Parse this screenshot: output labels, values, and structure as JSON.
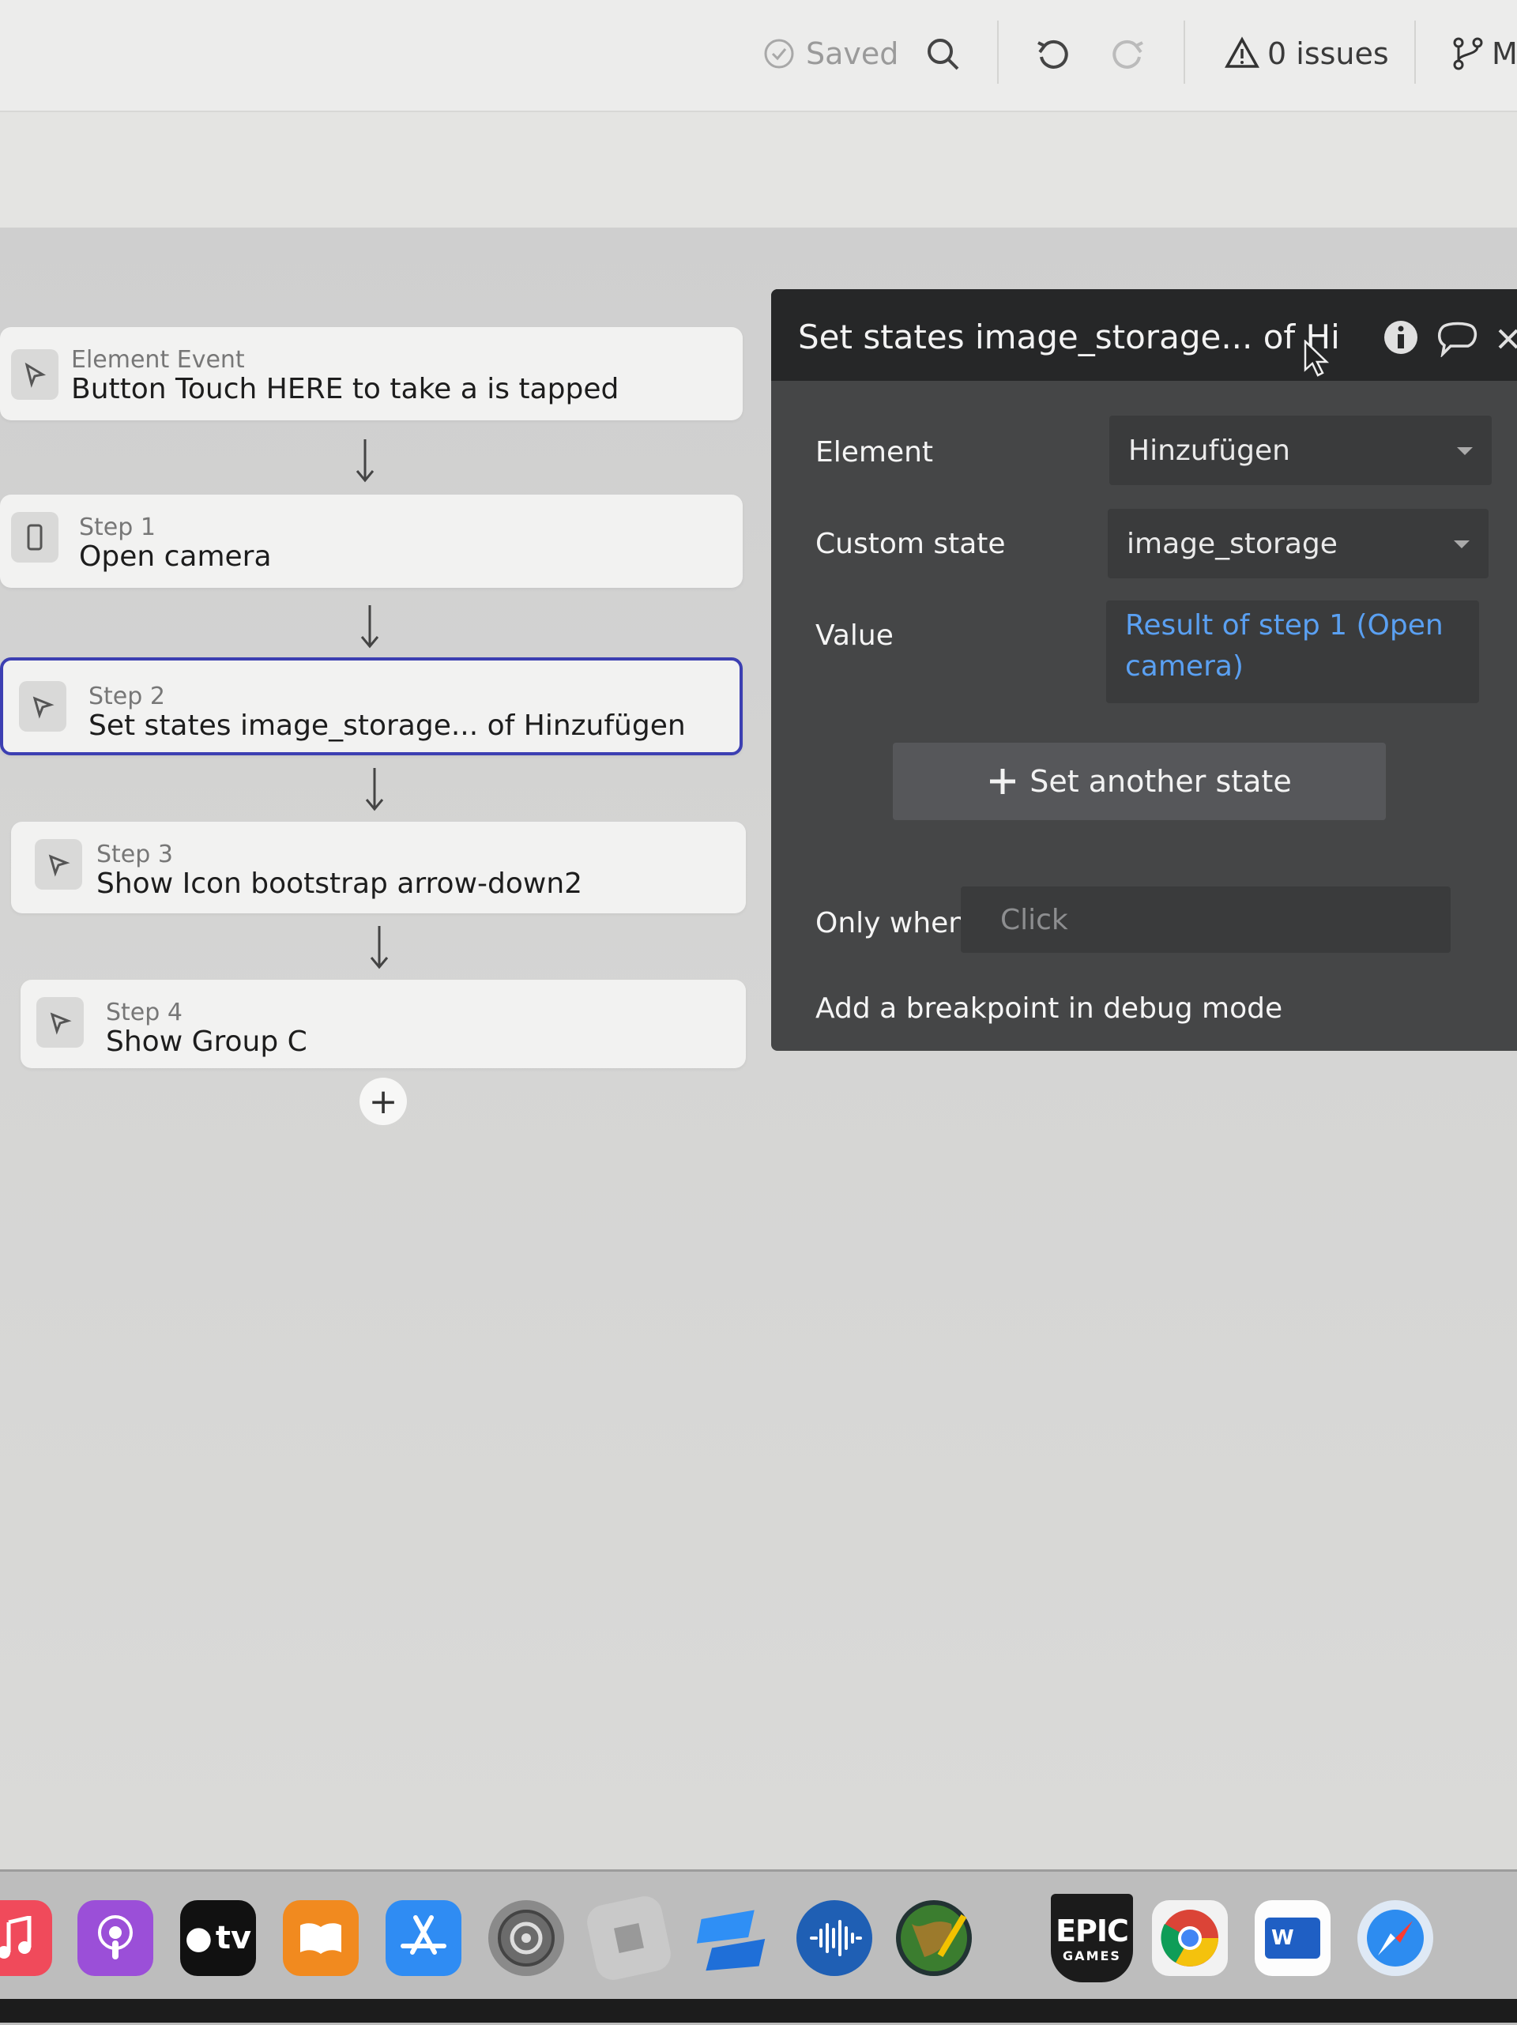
{
  "toolbar": {
    "saved_label": "Saved",
    "issues_label": "0 issues",
    "cut_label": "M"
  },
  "workflow": {
    "event": {
      "type_label": "Element Event",
      "title": "Button Touch HERE to take a is tapped"
    },
    "steps": [
      {
        "label": "Step 1",
        "title": "Open camera"
      },
      {
        "label": "Step 2",
        "title": "Set states image_storage... of Hinzufügen"
      },
      {
        "label": "Step 3",
        "title": "Show Icon bootstrap arrow-down2"
      },
      {
        "label": "Step 4",
        "title": "Show Group C"
      }
    ],
    "add_label": "+"
  },
  "panel": {
    "title": "Set states image_storage... of Hi",
    "element_label": "Element",
    "element_value": "Hinzufügen",
    "custom_state_label": "Custom state",
    "custom_state_value": "image_storage",
    "value_label": "Value",
    "value_line1": "Result of step 1 (Open",
    "value_line2": "camera)",
    "set_another_label": "Set another state",
    "only_when_label": "Only when",
    "only_when_placeholder": "Click",
    "breakpoint_label": "Add a breakpoint in debug mode"
  },
  "dock": {
    "apps": [
      "music-icon",
      "podcasts-icon",
      "appletv-icon",
      "books-icon",
      "appstore-icon",
      "settings-icon",
      "roblox-icon",
      "roblox-studio-icon",
      "soundwave-icon",
      "xcode-globe-icon",
      "epic-games-icon",
      "chrome-icon",
      "word-icon",
      "safari-icon"
    ],
    "appletv_text": "tv",
    "epic_text": "EPIC",
    "epic_sub": "GAMES",
    "word_text": "W"
  },
  "colors": {
    "panel_bg": "#454647",
    "panel_header": "#262728",
    "selected_border": "#3c3fb2",
    "link_blue": "#5aa0f2"
  }
}
